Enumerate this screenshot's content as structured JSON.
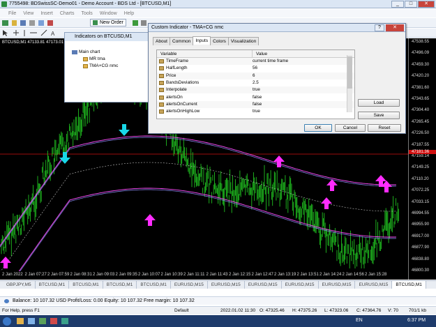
{
  "window": {
    "title": "7755498: BDSwissSC-Demo01 - Demo Account - BDS Ltd - [BTCUSD,M1]",
    "btn_min": "_",
    "btn_max": "□",
    "btn_close": "✕"
  },
  "menu": [
    "File",
    "View",
    "Insert",
    "Charts",
    "Tools",
    "Window",
    "Help"
  ],
  "toolbar": {
    "new_order": "New Order"
  },
  "chart": {
    "label": "BTCUSD,M1  47133.81 47173.01 4",
    "prices": [
      "47538.55",
      "47496.09",
      "47459.30",
      "47420.20",
      "47381.60",
      "47343.65",
      "47304.40",
      "47265.45",
      "47226.50",
      "47187.55",
      "47159.14",
      "47149.25",
      "47110.20",
      "47072.25",
      "47033.15",
      "46994.55",
      "46955.90",
      "46917.00",
      "46877.90",
      "46838.80",
      "46800.30"
    ],
    "times": [
      "2 Jan 2022",
      "2 Jan 07:27",
      "2 Jan 07:59",
      "2 Jan 08:31",
      "2 Jan 09:03",
      "2 Jan 09:35",
      "2 Jan 10:07",
      "2 Jan 10:39",
      "2 Jan 11:11",
      "2 Jan 11:43",
      "2 Jan 12:15",
      "2 Jan 12:47",
      "2 Jan 13:19",
      "2 Jan 13:51",
      "2 Jan 14:24",
      "2 Jan 14:56",
      "2 Jan 15:28"
    ],
    "highlight_price": "47181.36",
    "colors": {
      "bars": "#20c020",
      "band_upper": "#ff4dff",
      "band_lower": "#9090ff",
      "mid": "#c0c0c0",
      "arrow_up": "#ff2cff",
      "arrow_down": "#18d8e8",
      "hline": "#d01010"
    }
  },
  "indicators_panel": {
    "title": "Indicators on BTCUSD,M1",
    "root": "Main chart",
    "items": [
      "MR tma",
      "TMA+CG nmc"
    ]
  },
  "dialog": {
    "title": "Custom Indicator - TMA+CG nmc",
    "help": "?",
    "close": "✕",
    "tabs": [
      "About",
      "Common",
      "Inputs",
      "Colors",
      "Visualization"
    ],
    "active_tab": "Inputs",
    "col_variable": "Variable",
    "col_value": "Value",
    "params": [
      {
        "k": "TimeFrame",
        "v": "current time frame"
      },
      {
        "k": "HalfLength",
        "v": "56"
      },
      {
        "k": "Price",
        "v": "6"
      },
      {
        "k": "BandsDeviations",
        "v": "2.5"
      },
      {
        "k": "Interpolate",
        "v": "true"
      },
      {
        "k": "alertsOn",
        "v": "false"
      },
      {
        "k": "alertsOnCurrent",
        "v": "false"
      },
      {
        "k": "alertsOnHighLow",
        "v": "true"
      }
    ],
    "btn_load": "Load",
    "btn_save": "Save",
    "btn_ok": "OK",
    "btn_cancel": "Cancel",
    "btn_reset": "Reset"
  },
  "tabs": [
    "GBPJPY,M5",
    "BTCUSD,M1",
    "BTCUSD,M1",
    "BTCUSD,M1",
    "BTCUSD,M1",
    "EURUSD,M15",
    "EURUSD,M15",
    "EURUSD,M15",
    "EURUSD,M15",
    "EURUSD,M15",
    "EURUSD,M15",
    "BTCUSD,M1"
  ],
  "balance": "Balance: 10 107.32 USD  Profit/Loss: 0.00  Equity: 10 107.32  Free margin: 10 107.32",
  "status": {
    "help": "For Help, press F1",
    "profile": "Default",
    "datetime": "2022.01.02 11:30",
    "open": "O: 47325.46",
    "high": "H: 47375.26",
    "low": "L: 47323.06",
    "close": "C: 47364.76",
    "volume": "V: 70",
    "traffic": "701/1 kb"
  },
  "taskbar": {
    "lang": "EN",
    "time": "6:37 PM"
  }
}
